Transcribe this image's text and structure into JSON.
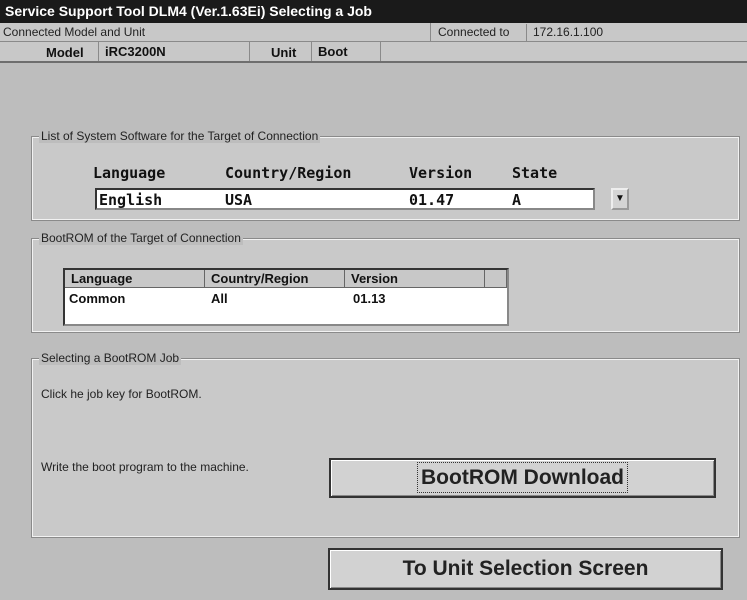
{
  "window": {
    "title": "Service Support Tool DLM4 (Ver.1.63Ei) Selecting a Job"
  },
  "connection": {
    "section_label": "Connected Model and Unit",
    "connected_to_label": "Connected to",
    "ip": "172.16.1.100",
    "model_label": "Model",
    "model_value": "iRC3200N",
    "unit_label": "Unit",
    "unit_value": "Boot"
  },
  "system_software": {
    "legend": "List of System Software for the Target of Connection",
    "headers": {
      "language": "Language",
      "country": "Country/Region",
      "version": "Version",
      "state": "State"
    },
    "selected": {
      "language": "English",
      "country": "USA",
      "version": "01.47",
      "state": "A"
    }
  },
  "bootrom": {
    "legend": "BootROM of the Target of Connection",
    "headers": {
      "language": "Language",
      "country": "Country/Region",
      "version": "Version"
    },
    "rows": [
      {
        "language": "Common",
        "country": "All",
        "version": "01.13"
      }
    ]
  },
  "job": {
    "legend": "Selecting a BootROM Job",
    "instruction": "Click he job key for BootROM.",
    "write_text": "Write the boot program to the machine.",
    "download_button": "BootROM Download"
  },
  "footer": {
    "unit_selection_button": "To Unit Selection Screen"
  }
}
